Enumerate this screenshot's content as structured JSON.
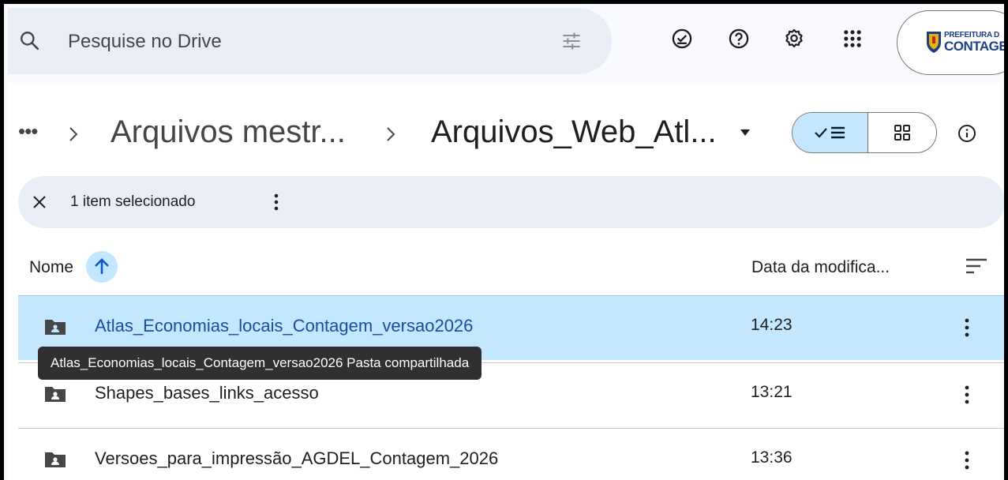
{
  "search": {
    "placeholder": "Pesquise no Drive"
  },
  "account": {
    "logo_line1": "PREFEITURA D",
    "logo_line2": "CONTAGEM"
  },
  "breadcrumb": {
    "ellipsis": "•••",
    "items": [
      {
        "label": "Arquivos mestr..."
      },
      {
        "label": "Arquivos_Web_Atl..."
      }
    ]
  },
  "selection": {
    "count_text": "1 item selecionado"
  },
  "table": {
    "headers": {
      "name": "Nome",
      "modified": "Data da modifica..."
    },
    "rows": [
      {
        "name": "Atlas_Economias_locais_Contagem_versao2026",
        "modified": "14:23",
        "selected": true
      },
      {
        "name": "Shapes_bases_links_acesso",
        "modified": "13:21",
        "selected": false
      },
      {
        "name": "Versoes_para_impressão_AGDEL_Contagem_2026",
        "modified": "13:36",
        "selected": false
      }
    ]
  },
  "tooltip": {
    "text": "Atlas_Economias_locais_Contagem_versao2026 Pasta compartilhada"
  },
  "colors": {
    "selected_row": "#c2e7ff",
    "search_bg": "#e9eef6",
    "accent": "#0b57d0"
  }
}
